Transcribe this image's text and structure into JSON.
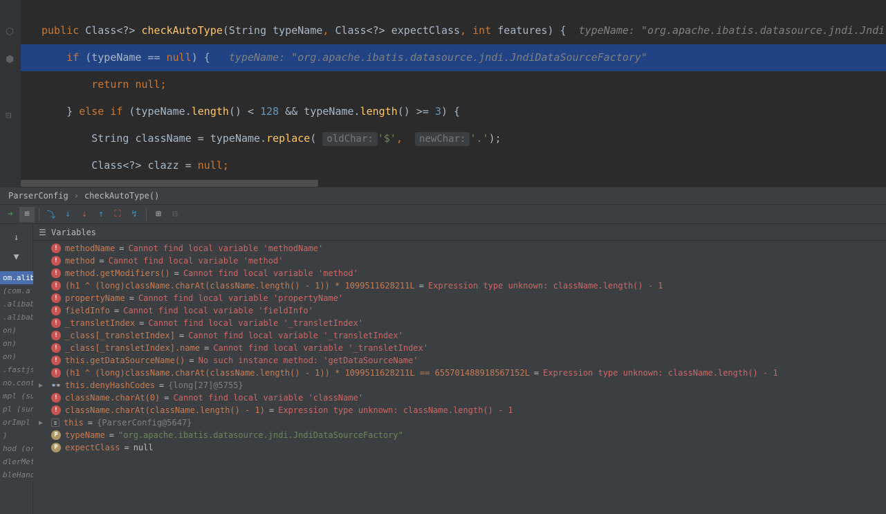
{
  "breadcrumb": {
    "class": "ParserConfig",
    "method": "checkAutoType()"
  },
  "code": {
    "l1_public": "public",
    "l1_class": " Class<?> ",
    "l1_method": "checkAutoType",
    "l1_params_open": "(String typeName",
    "l1_comma1": ",",
    "l1_params_mid": " Class<?> expectClass",
    "l1_comma2": ",",
    "l1_int": " int",
    "l1_params_end": " features",
    "l1_close": ") {",
    "l1_comment": "  typeName: \"org.apache.ibatis.datasource.jndi.Jndi",
    "l2_if": "if",
    "l2_cond": " (typeName == ",
    "l2_null": "null",
    "l2_close": ") {",
    "l2_comment": "   typeName: \"org.apache.ibatis.datasource.jndi.JndiDataSourceFactory\"",
    "l3_return": "return ",
    "l3_null": "null",
    "l3_semi": ";",
    "l4_brace": "} ",
    "l4_else": "else if",
    "l4_cond1": " (typeName.",
    "l4_length": "length",
    "l4_cond2": "() < ",
    "l4_num1": "128",
    "l4_cond3": " && typeName.",
    "l4_cond4": "() >= ",
    "l4_num2": "3",
    "l4_close": ") {",
    "l5_text": "String className = typeName.",
    "l5_replace": "replace",
    "l5_open": "( ",
    "l5_hint1": "oldChar:",
    "l5_str1": "'$'",
    "l5_comma": ",",
    "l5_hint2": "newChar:",
    "l5_str2": "'.'",
    "l5_close": ");",
    "l6_text": "Class<?> clazz = ",
    "l6_null": "null",
    "l6_semi": ";"
  },
  "variables_header": "Variables",
  "vars": [
    {
      "icon": "error",
      "name": "methodName",
      "eq": " = ",
      "error": "Cannot find local variable 'methodName'"
    },
    {
      "icon": "error",
      "name": "method",
      "eq": " = ",
      "error": "Cannot find local variable 'method'"
    },
    {
      "icon": "error",
      "name": "method.getModifiers()",
      "eq": " = ",
      "error": "Cannot find local variable 'method'"
    },
    {
      "icon": "error",
      "name": "(h1 ^ (long)className.charAt(className.length() - 1)) * 1099511628211L",
      "eq": " = ",
      "error": "Expression type unknown: className.length() - 1"
    },
    {
      "icon": "error",
      "name": "propertyName",
      "eq": " = ",
      "error": "Cannot find local variable 'propertyName'"
    },
    {
      "icon": "error",
      "name": "fieldInfo",
      "eq": " = ",
      "error": "Cannot find local variable 'fieldInfo'"
    },
    {
      "icon": "error",
      "name": "_transletIndex",
      "eq": " = ",
      "error": "Cannot find local variable '_transletIndex'"
    },
    {
      "icon": "error",
      "name": "_class[_transletIndex]",
      "eq": " = ",
      "error": "Cannot find local variable '_transletIndex'"
    },
    {
      "icon": "error",
      "name": "_class[_transletIndex].name",
      "eq": " = ",
      "error": "Cannot find local variable '_transletIndex'"
    },
    {
      "icon": "error",
      "name": "this.getDataSourceName()",
      "eq": " = ",
      "error": "No such instance method: 'getDataSourceName'"
    },
    {
      "icon": "error",
      "name": "(h1 ^ (long)className.charAt(className.length() - 1)) * 1099511628211L == 655701488918567152L",
      "eq": " = ",
      "error": "Expression type unknown: className.length() - 1"
    },
    {
      "icon": "watch",
      "arrow": "▶",
      "name": "this.denyHashCodes",
      "eq": " = ",
      "gray": "{long[27]@5755}"
    },
    {
      "icon": "error",
      "name": "className.charAt(0)",
      "eq": " = ",
      "error": "Cannot find local variable 'className'"
    },
    {
      "icon": "error",
      "name": "className.charAt(className.length() - 1)",
      "eq": " = ",
      "error": "Expression type unknown: className.length() - 1"
    },
    {
      "icon": "equals",
      "arrow": "▶",
      "name": "this",
      "eq": " = ",
      "gray": "{ParserConfig@5647}"
    },
    {
      "icon": "primitive",
      "name": "typeName",
      "eq": " = ",
      "str": "\"org.apache.ibatis.datasource.jndi.JndiDataSourceFactory\""
    },
    {
      "icon": "primitive",
      "name": "expectClass",
      "eq": " = ",
      "value": "null"
    }
  ],
  "frames": [
    {
      "text": "om.aliba",
      "selected": true
    },
    {
      "text": "(com.a"
    },
    {
      "text": ".alibaba"
    },
    {
      "text": ".alibaba"
    },
    {
      "text": "on)"
    },
    {
      "text": "on)"
    },
    {
      "text": "on)"
    },
    {
      "text": ".fastjson"
    },
    {
      "text": "no.contr"
    },
    {
      "text": "mpl (sun"
    },
    {
      "text": "pl (sun."
    },
    {
      "text": "orImpl ("
    },
    {
      "text": ")"
    },
    {
      "text": "hod (org"
    },
    {
      "text": "dlerMet"
    },
    {
      "text": "bleHand"
    }
  ],
  "toolbar": {
    "restart": "↻",
    "stepover": "⤵",
    "stepinto": "↓",
    "forcestepinto": "⇣",
    "stepout": "↑",
    "droptoframe": "⛶",
    "runcursor": "↯",
    "evaluate": "⌨",
    "trace": "⊞",
    "mute": "⊟"
  },
  "side": {
    "down": "↓",
    "filter": "▼",
    "add": "+",
    "up": "▲",
    "down2": "▼",
    "copy": "⎘",
    "glasses": "👓"
  }
}
